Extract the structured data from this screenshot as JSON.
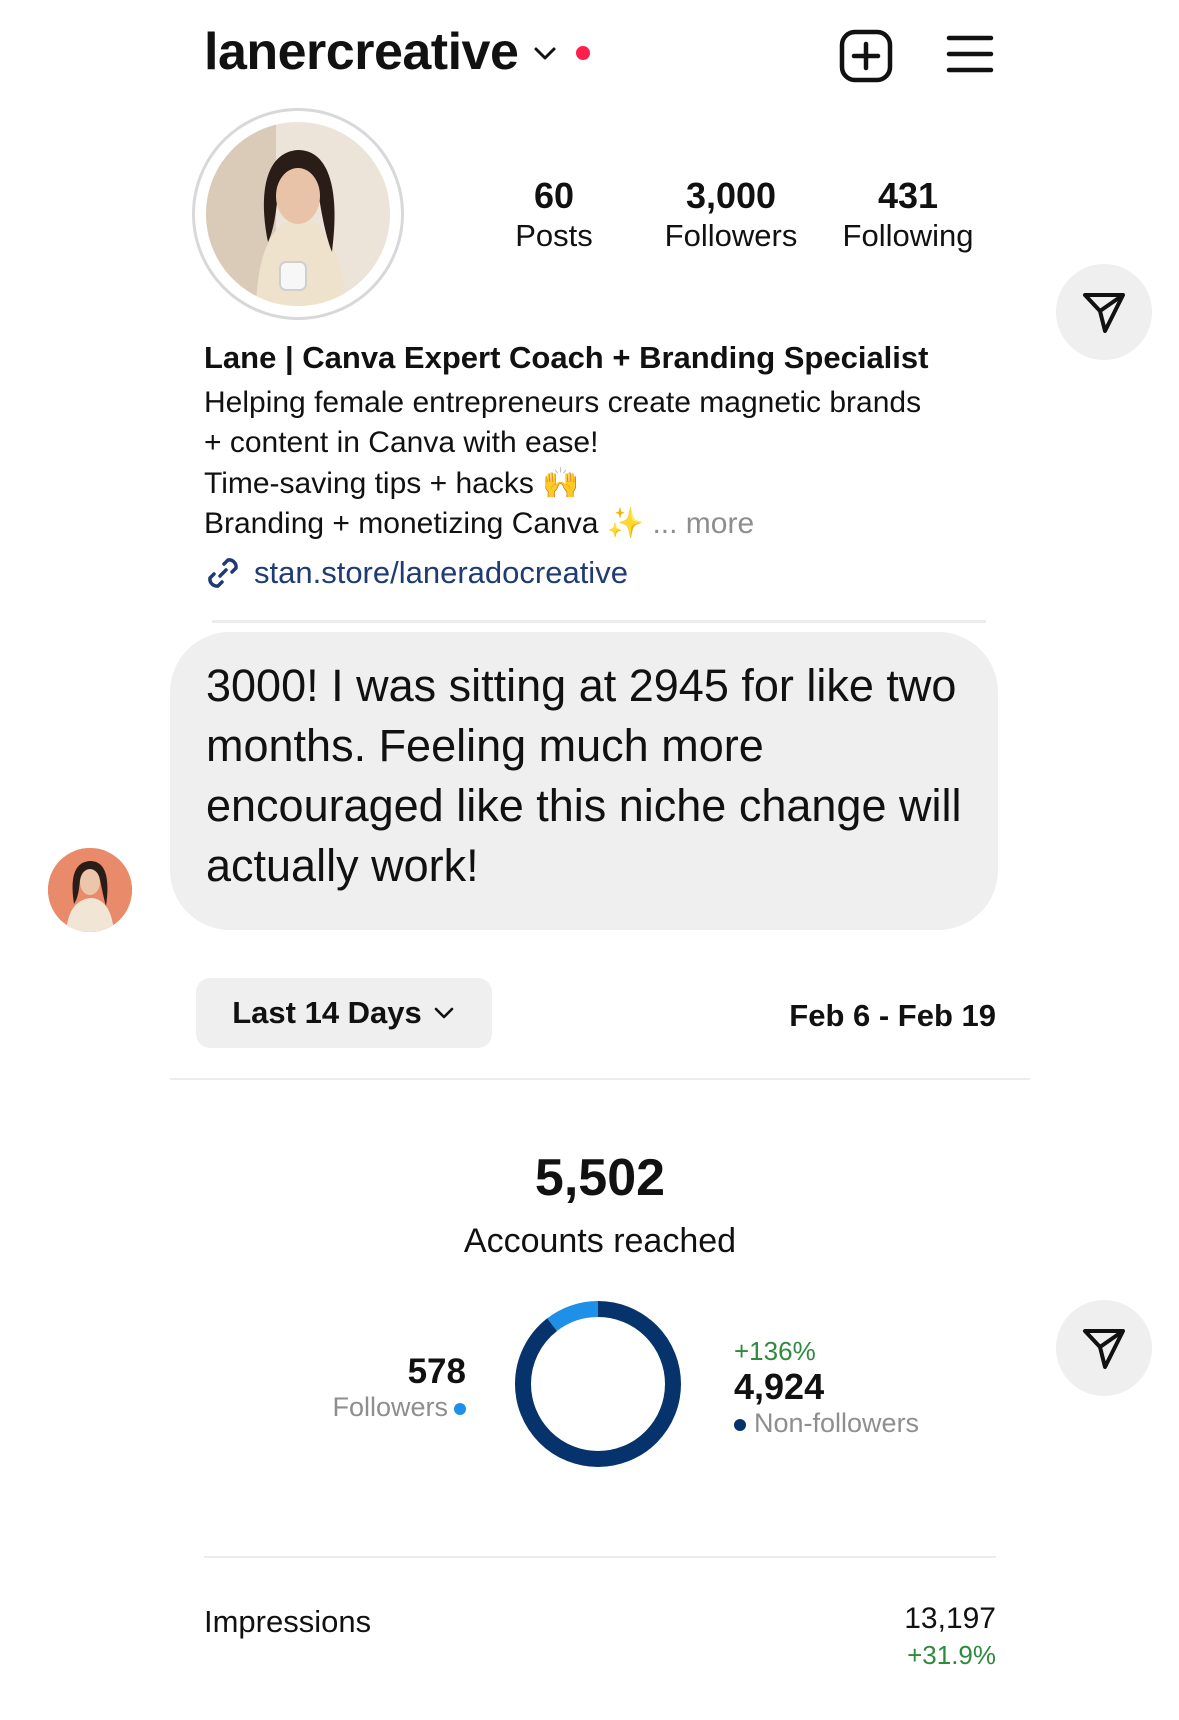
{
  "header": {
    "username": "lanercreative",
    "new_post_icon": "plus-square-icon",
    "menu_icon": "hamburger-menu-icon",
    "notification_dot_color": "#ff1f4b"
  },
  "profile": {
    "stats": [
      {
        "value": "60",
        "label": "Posts"
      },
      {
        "value": "3,000",
        "label": "Followers"
      },
      {
        "value": "431",
        "label": "Following"
      }
    ],
    "bio": {
      "name": "Lane | Canva Expert Coach + Branding Specialist",
      "line1": "Helping female entrepreneurs create magnetic brands",
      "line2": "+ content in Canva with ease!",
      "line3": "Time-saving tips + hacks",
      "line3_emoji": "🙌",
      "line4": "Branding + monetizing Canva",
      "line4_emoji": "✨",
      "more": "... more"
    },
    "link": "stan.store/laneradocreative"
  },
  "message": {
    "text": "3000! I was sitting at 2945 for like two months. Feeling much more encouraged like this niche change will actually work!"
  },
  "insights": {
    "range_label": "Last 14 Days",
    "dates": "Feb 6 - Feb 19",
    "accounts_reached": "5,502",
    "accounts_reached_label": "Accounts reached",
    "followers_value": "578",
    "followers_label": "Followers",
    "nonfollowers_change": "+136%",
    "nonfollowers_value": "4,924",
    "nonfollowers_label": "Non-followers",
    "followers_share": 0.105,
    "followers_color": "#1e90e8",
    "nonfollowers_color": "#06336b",
    "impressions_label": "Impressions",
    "impressions_value": "13,197",
    "impressions_change": "+31.9%",
    "positive_color": "#2e8b3e"
  }
}
